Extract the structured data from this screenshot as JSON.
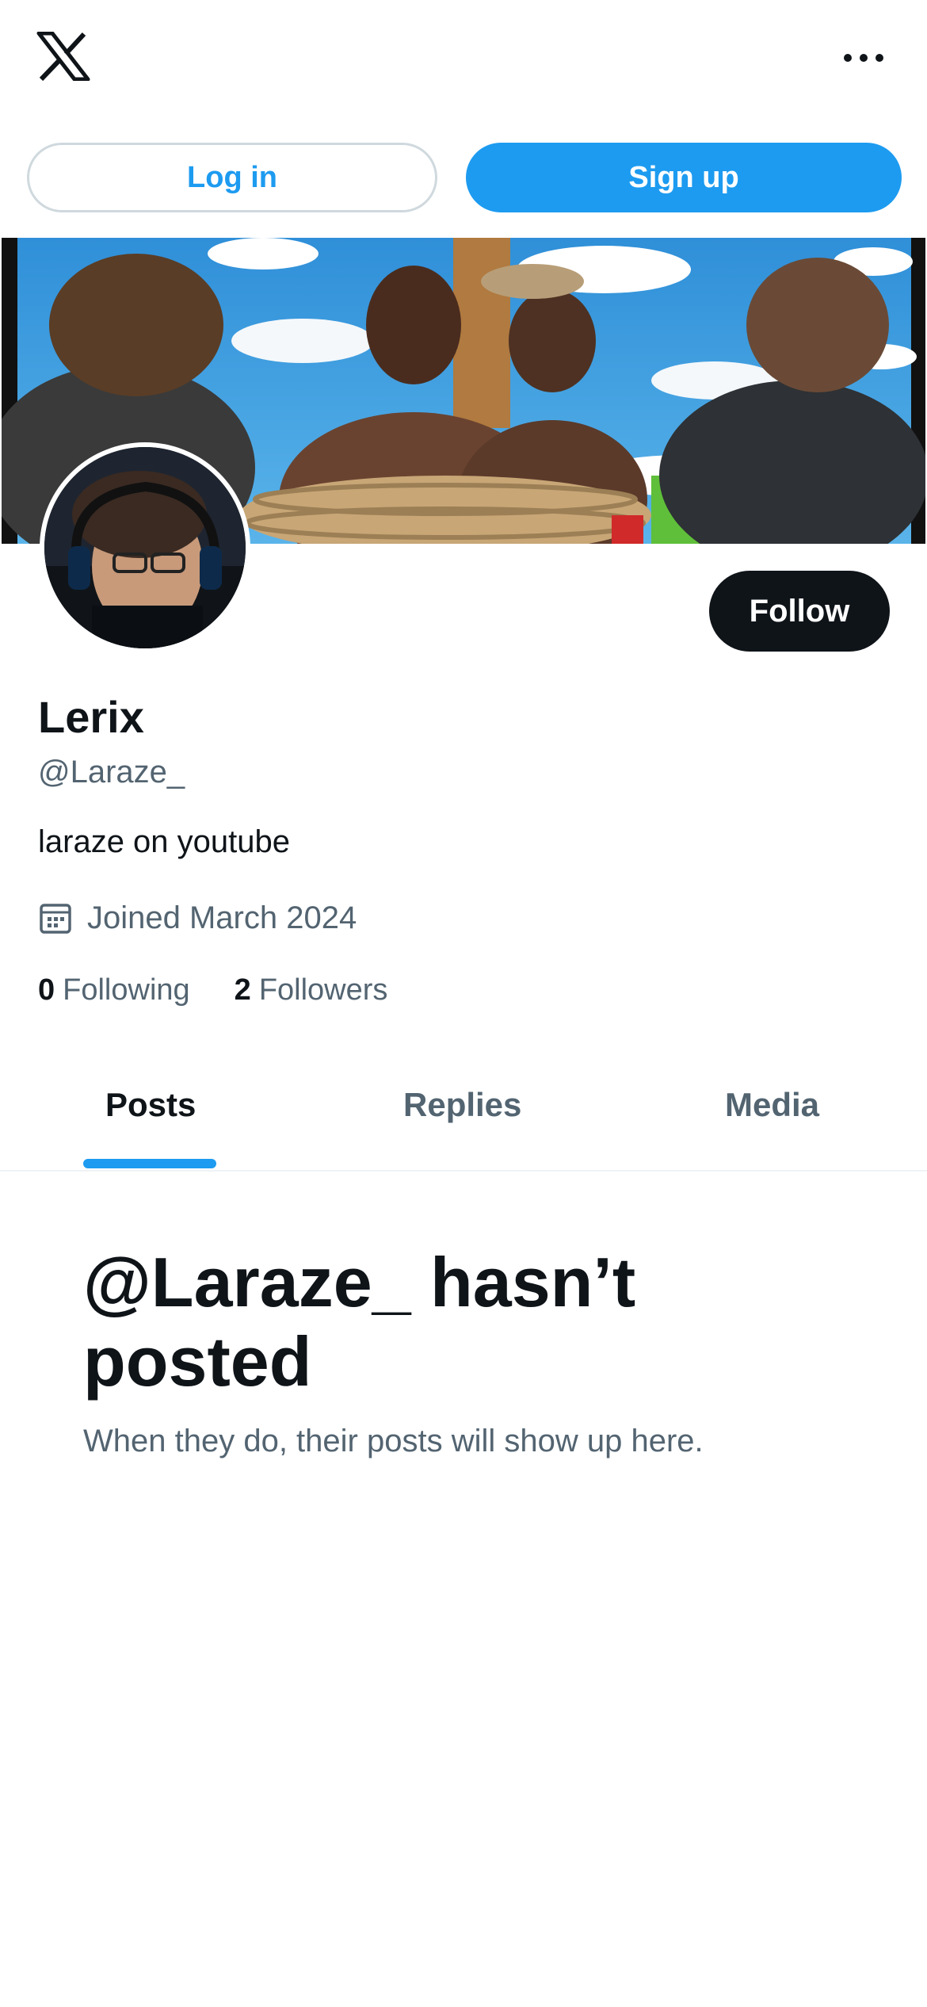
{
  "header": {
    "logo_icon": "x-logo-icon",
    "more_icon": "more-horizontal-icon"
  },
  "auth": {
    "login_label": "Log in",
    "signup_label": "Sign up"
  },
  "profile": {
    "name": "Lerix",
    "handle": "@Laraze_",
    "bio": "laraze on youtube",
    "joined_text": "Joined March 2024",
    "joined_icon": "calendar-icon",
    "follow_label": "Follow",
    "following_count": "0",
    "following_label": "Following",
    "followers_count": "2",
    "followers_label": "Followers"
  },
  "tabs": [
    {
      "label": "Posts",
      "active": true
    },
    {
      "label": "Replies",
      "active": false
    },
    {
      "label": "Media",
      "active": false
    }
  ],
  "empty_state": {
    "title": "@Laraze_ hasn’t posted",
    "subtitle": "When they do, their posts will show up here."
  },
  "colors": {
    "accent": "#1d9bf0",
    "text": "#0f1419",
    "secondary_text": "#536471"
  }
}
